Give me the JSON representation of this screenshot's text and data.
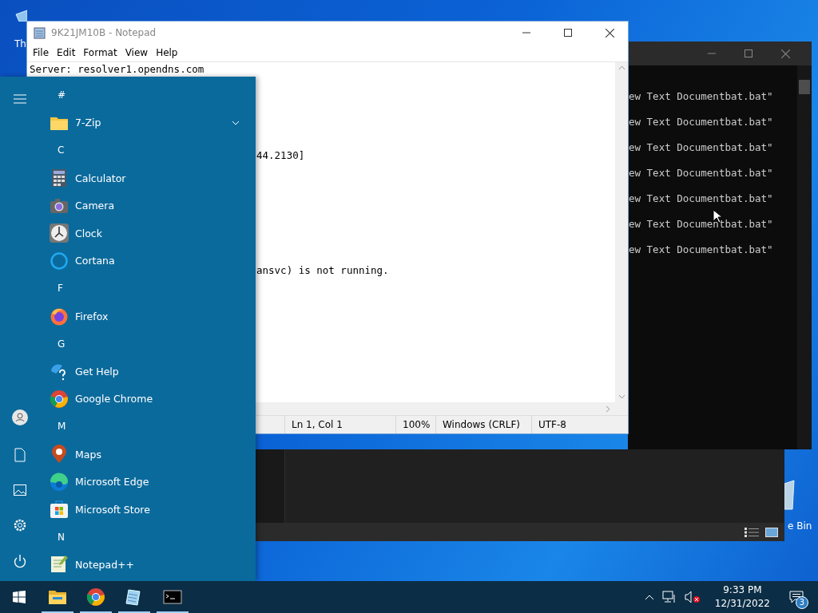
{
  "desktop": {
    "icons": [
      {
        "label": "Th"
      },
      {
        "label": "e Bin"
      }
    ]
  },
  "console": {
    "lines": [
      "ew Text Documentbat.bat\"",
      "ew Text Documentbat.bat\"",
      "ew Text Documentbat.bat\"",
      "ew Text Documentbat.bat\"",
      "ew Text Documentbat.bat\"",
      "ew Text Documentbat.bat\"",
      "ew Text Documentbat.bat\""
    ]
  },
  "notepad": {
    "title": "9K21JM10B - Notepad",
    "menu": [
      "File",
      "Edit",
      "Format",
      "View",
      "Help"
    ],
    "lines": [
      {
        "kind": "full",
        "text": "Server:  resolver1.opendns.com"
      },
      {
        "kind": "fragment",
        "text": "44.2130]"
      },
      {
        "kind": "fragment",
        "text": "ansvc) is not running."
      }
    ],
    "status_bar": [
      "Ln 1, Col 1",
      "100%",
      "Windows (CRLF)",
      "UTF-8"
    ]
  },
  "start_menu": {
    "items": [
      {
        "kind": "header",
        "label": "#"
      },
      {
        "kind": "app",
        "label": "7-Zip",
        "expandable": true
      },
      {
        "kind": "header",
        "label": "C"
      },
      {
        "kind": "app",
        "label": "Calculator",
        "expandable": false
      },
      {
        "kind": "app",
        "label": "Camera",
        "expandable": false
      },
      {
        "kind": "app",
        "label": "Clock",
        "expandable": false
      },
      {
        "kind": "app",
        "label": "Cortana",
        "expandable": false
      },
      {
        "kind": "header",
        "label": "F"
      },
      {
        "kind": "app",
        "label": "Firefox",
        "expandable": false
      },
      {
        "kind": "header",
        "label": "G"
      },
      {
        "kind": "app",
        "label": "Get Help",
        "expandable": false
      },
      {
        "kind": "app",
        "label": "Google Chrome",
        "expandable": false
      },
      {
        "kind": "header",
        "label": "M"
      },
      {
        "kind": "app",
        "label": "Maps",
        "expandable": false
      },
      {
        "kind": "app",
        "label": "Microsoft Edge",
        "expandable": false
      },
      {
        "kind": "app",
        "label": "Microsoft Store",
        "expandable": false
      },
      {
        "kind": "header",
        "label": "N"
      },
      {
        "kind": "app",
        "label": "Notepad++",
        "expandable": false
      }
    ]
  },
  "taskbar": {
    "apps": [
      {
        "running": true
      },
      {
        "running": true
      },
      {
        "running": true
      },
      {
        "running": true
      }
    ],
    "time": "9:33 PM",
    "date": "12/31/2022",
    "notifications": "3"
  }
}
